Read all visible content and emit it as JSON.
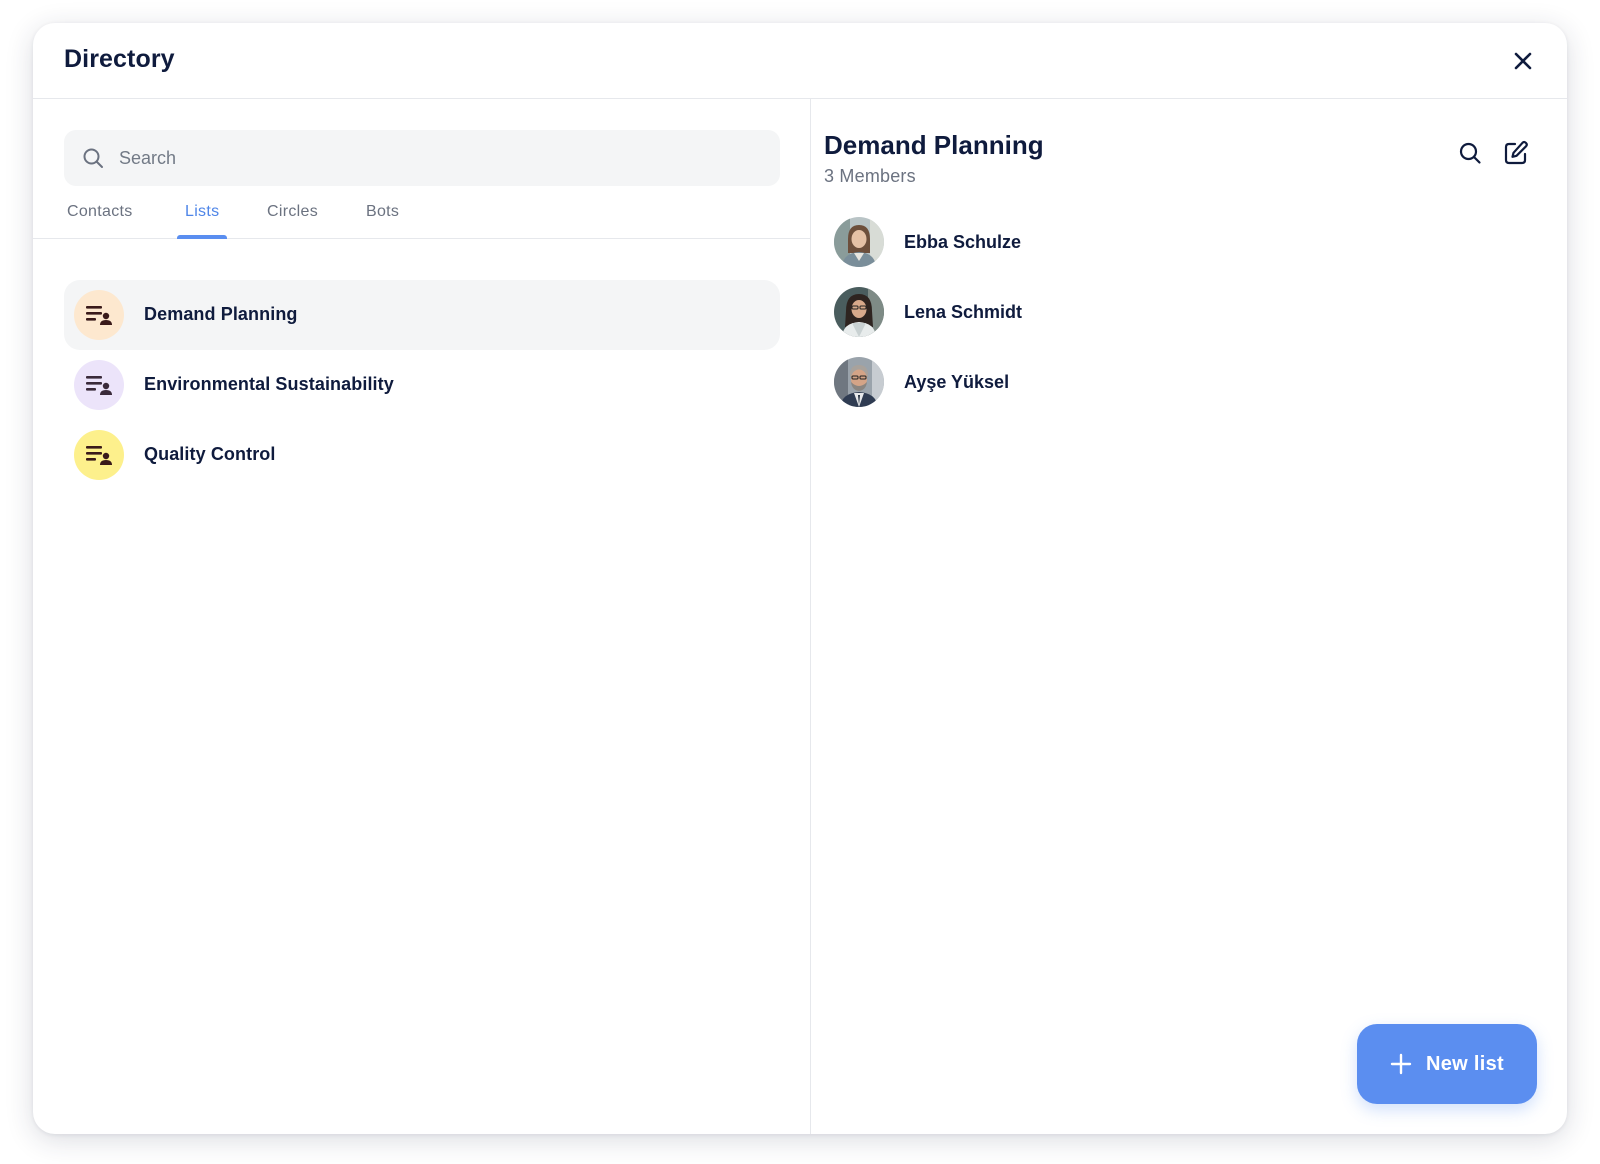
{
  "dialog": {
    "title": "Directory",
    "close_icon": "close-icon"
  },
  "search": {
    "placeholder": "Search",
    "value": "",
    "icon": "search-icon"
  },
  "tabs": [
    {
      "label": "Contacts",
      "active": false
    },
    {
      "label": "Lists",
      "active": true
    },
    {
      "label": "Circles",
      "active": false
    },
    {
      "label": "Bots",
      "active": false
    }
  ],
  "lists": [
    {
      "label": "Demand Planning",
      "selected": true,
      "icon": "list-user-icon",
      "color": "#fde8cf"
    },
    {
      "label": "Environmental Sustainability",
      "selected": false,
      "icon": "list-user-icon",
      "color": "#ece4fa"
    },
    {
      "label": "Quality Control",
      "selected": false,
      "icon": "list-user-icon",
      "color": "#fdf08c"
    }
  ],
  "detail": {
    "title": "Demand Planning",
    "subtitle": "3 Members",
    "search_icon": "search-icon",
    "edit_icon": "edit-icon",
    "members": [
      {
        "name": "Ebba Schulze"
      },
      {
        "name": "Lena Schmidt"
      },
      {
        "name": "Ayşe Yüksel"
      }
    ]
  },
  "new_list_button": {
    "label": "New list",
    "icon": "plus-icon"
  },
  "colors": {
    "accent": "#5b8ef0",
    "text_primary": "#0f1b3d",
    "text_secondary": "#6b7280",
    "selected_bg": "#f4f5f6",
    "list_icon_glyph": "#3a1a1a"
  }
}
